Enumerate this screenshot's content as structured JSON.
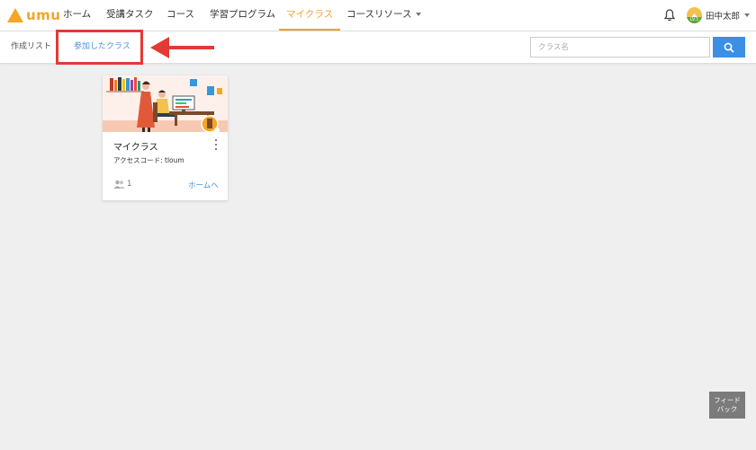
{
  "brand": {
    "logo_text": "umu",
    "accent": "#f5a623"
  },
  "nav": {
    "items": [
      {
        "label": "ホーム"
      },
      {
        "label": "受講タスク"
      },
      {
        "label": "コース"
      },
      {
        "label": "学習プログラム"
      },
      {
        "label": "マイクラス",
        "active": true
      },
      {
        "label": "コースリソース",
        "dropdown": true
      }
    ]
  },
  "header": {
    "notification_icon": "bell-icon",
    "user": {
      "name": "田中太郎",
      "level": "LV.1"
    }
  },
  "subnav": {
    "tabs": [
      {
        "label": "作成リスト"
      },
      {
        "label": "参加したクラス",
        "active": true
      }
    ],
    "search": {
      "placeholder": "クラス名",
      "value": "",
      "button_icon": "search-icon",
      "button_color": "#3b8fe5"
    }
  },
  "annotation": {
    "box_color": "#e53935",
    "arrow": "arrow-left-icon"
  },
  "cards": [
    {
      "title": "マイクラス",
      "access_code": "アクセスコード: tloum",
      "members": "1",
      "home_link": "ホームへ"
    }
  ],
  "feedback": {
    "line1": "フィード",
    "line2": "バック"
  }
}
